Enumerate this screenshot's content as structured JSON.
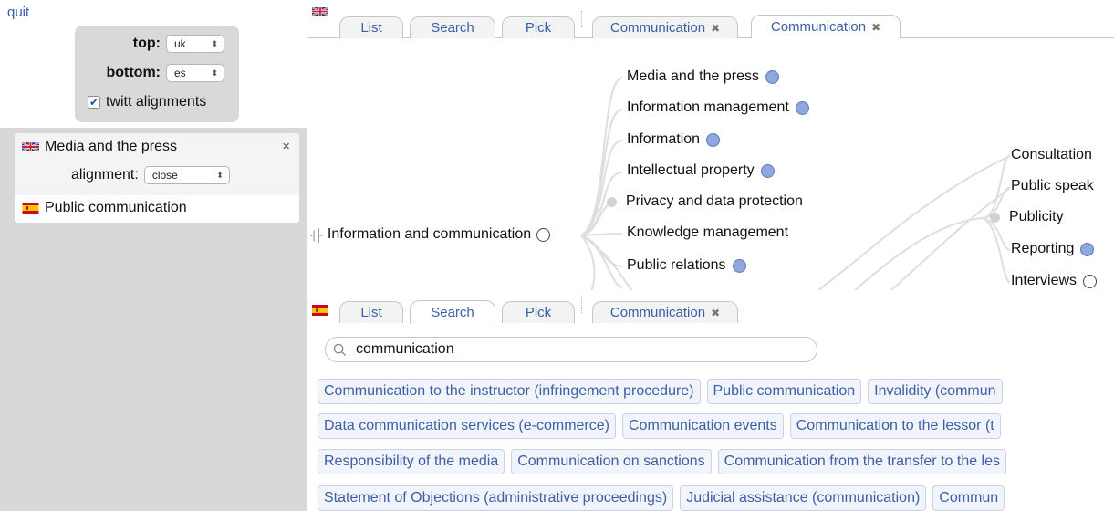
{
  "quit_label": "quit",
  "settings": {
    "top_label": "top:",
    "top_value": "uk",
    "bottom_label": "bottom:",
    "bottom_value": "es",
    "twitt_label": "twitt alignments",
    "twitt_checked": true
  },
  "alignment": {
    "top_term": "Media and the press",
    "close_symbol": "×",
    "alignment_label": "alignment:",
    "alignment_value": "close",
    "bottom_term": "Public communication"
  },
  "top_pane": {
    "flag": "uk-flag",
    "tabs": [
      {
        "label": "List"
      },
      {
        "label": "Search"
      },
      {
        "label": "Pick"
      },
      {
        "label": "Communication",
        "closable": true
      },
      {
        "label": "Communication",
        "closable": true
      }
    ],
    "active_tab": 4
  },
  "graph": {
    "root": "Information and communication",
    "root_handle": "·|├",
    "nodes": [
      {
        "label": "Media and the press",
        "dot": "blue"
      },
      {
        "label": "Information management",
        "dot": "blue"
      },
      {
        "label": "Information",
        "dot": "blue"
      },
      {
        "label": "Intellectual property",
        "dot": "blue"
      },
      {
        "label": "Privacy and data protection",
        "dot": "grey-left"
      },
      {
        "label": "Knowledge management",
        "dot": "none"
      },
      {
        "label": "Public relations",
        "dot": "blue"
      }
    ],
    "far_nodes": [
      {
        "label": "Consultation",
        "dot": "none"
      },
      {
        "label": "Public speak",
        "dot": "none"
      },
      {
        "label": "Publicity",
        "dot": "grey-left"
      },
      {
        "label": "Reporting",
        "dot": "blue"
      },
      {
        "label": "Interviews",
        "dot": "open"
      }
    ]
  },
  "bottom_pane": {
    "flag": "es-flag",
    "tabs": [
      {
        "label": "List"
      },
      {
        "label": "Search"
      },
      {
        "label": "Pick"
      },
      {
        "label": "Communication",
        "closable": true
      }
    ],
    "active_tab": 1,
    "search_value": "communication",
    "results": [
      [
        "Communication to the instructor (infringement procedure)",
        "Public communication",
        "Invalidity (commun"
      ],
      [
        "Data communication services (e-commerce)",
        "Communication events",
        "Communication to the lessor (t"
      ],
      [
        "Responsibility of the media",
        "Communication on sanctions",
        "Communication from the transfer to the les"
      ],
      [
        "Statement of Objections (administrative proceedings)",
        "Judicial assistance (communication)",
        "Commun"
      ]
    ]
  },
  "colors": {
    "accent": "#3960a8",
    "node_blue": "#8fa6de",
    "panel_grey": "#d8d8d8"
  }
}
